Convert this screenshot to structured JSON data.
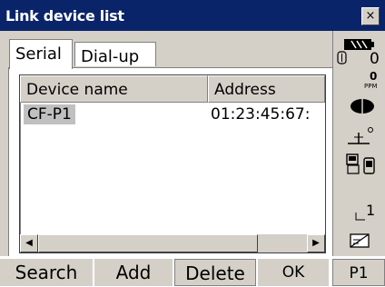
{
  "window": {
    "title": "Link device list",
    "close_label": "×"
  },
  "tabs": [
    {
      "label": "Serial"
    },
    {
      "label": "Dial-up"
    }
  ],
  "list": {
    "columns": [
      "Device name",
      "Address"
    ],
    "rows": [
      {
        "device": "CF-P1",
        "address": "01:23:45:67:"
      }
    ]
  },
  "status": {
    "prism_value": "0",
    "ppm_value": "0",
    "ppm_label": "PPM",
    "page_value": "1"
  },
  "icons": {
    "battery": "battery-icon",
    "prism": "prism-icon",
    "laser": "laser-icon",
    "tilt": "tilt-icon",
    "bluetooth": "device-link-icon",
    "input_mode": "input-mode-icon",
    "memory": "memory-card-icon"
  },
  "softkeys": [
    "Search",
    "Add",
    "Delete",
    "OK",
    "P1"
  ],
  "colors": {
    "titlebar": "#0a246a",
    "face": "#d4d0c8",
    "selection": "#c0c0c0"
  }
}
